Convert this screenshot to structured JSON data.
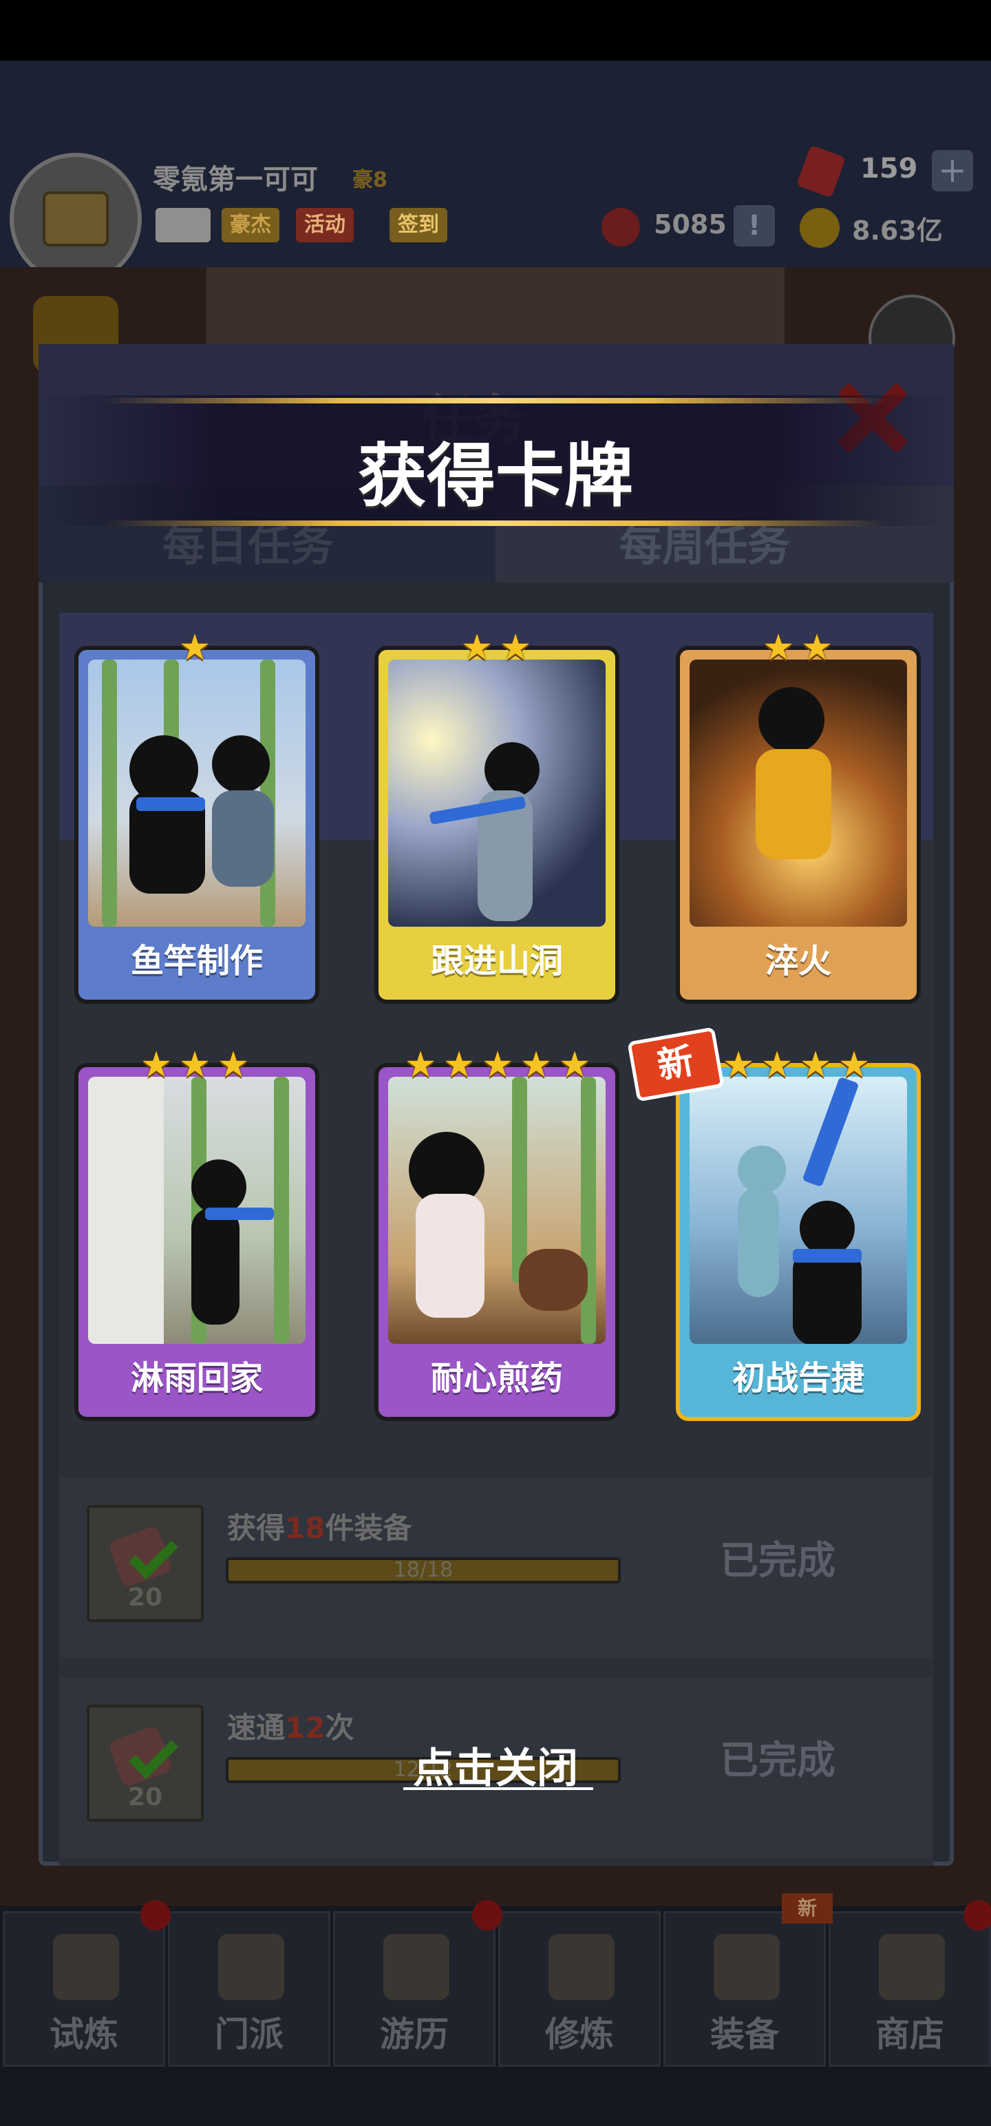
{
  "player": {
    "name": "零氪第一可可",
    "vip": "豪8",
    "buttons": [
      "豪杰",
      "活动",
      "签到"
    ],
    "gems": "159",
    "medals": "5085",
    "gold": "8.63亿"
  },
  "task_panel": {
    "title": "任务",
    "tabs": [
      "每日任务",
      "每周任务"
    ],
    "rows": [
      {
        "desc_prefix": "获得",
        "desc_num": "18",
        "desc_suffix": "件装备",
        "progress": "18/18",
        "reward": "20",
        "status": "已完成"
      },
      {
        "desc_prefix": "速通",
        "desc_num": "12",
        "desc_suffix": "次",
        "progress": "12/12",
        "reward": "20",
        "status": "已完成"
      }
    ]
  },
  "modal": {
    "title": "获得卡牌",
    "new_badge": "新",
    "close_hint": "点击关闭",
    "cards": [
      {
        "name": "鱼竿制作",
        "stars": 1,
        "rarity": "blue"
      },
      {
        "name": "跟进山洞",
        "stars": 2,
        "rarity": "yellow"
      },
      {
        "name": "淬火",
        "stars": 2,
        "rarity": "orange"
      },
      {
        "name": "淋雨回家",
        "stars": 3,
        "rarity": "purple"
      },
      {
        "name": "耐心煎药",
        "stars": 5,
        "rarity": "purple"
      },
      {
        "name": "初战告捷",
        "stars": 4,
        "rarity": "cyan",
        "is_new": true
      }
    ]
  },
  "bottom_nav": {
    "items": [
      "试炼",
      "门派",
      "游历",
      "修炼",
      "装备",
      "商店"
    ],
    "new_tag": "新"
  },
  "colors": {
    "gold_accent": "#e7b844",
    "star": "#f6c324",
    "new_badge": "#e2411e"
  }
}
